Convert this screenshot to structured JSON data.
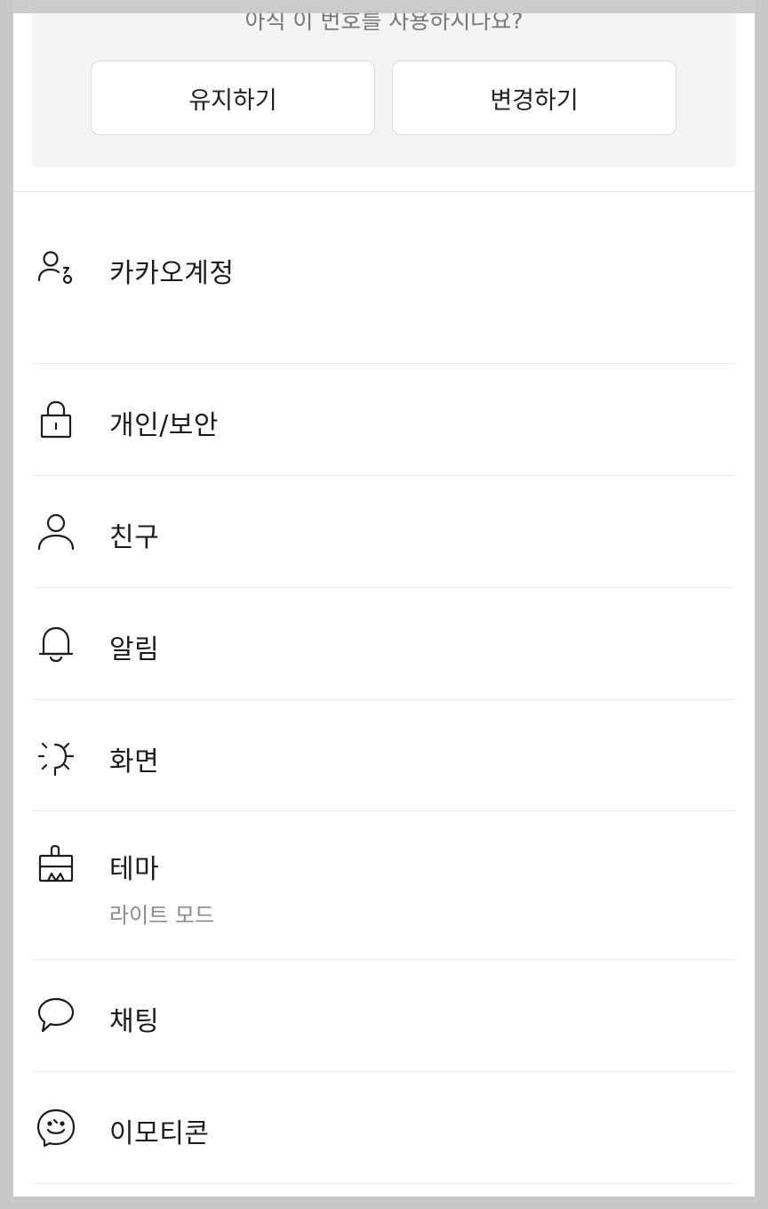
{
  "banner": {
    "question": "아직 이 번호를 사용하시나요?",
    "keep_label": "유지하기",
    "change_label": "변경하기"
  },
  "menu": {
    "items": [
      {
        "label": "카카오계정",
        "icon": "user-key-icon"
      },
      {
        "label": "개인/보안",
        "icon": "lock-icon"
      },
      {
        "label": "친구",
        "icon": "person-icon"
      },
      {
        "label": "알림",
        "icon": "bell-icon"
      },
      {
        "label": "화면",
        "icon": "brightness-icon"
      },
      {
        "label": "테마",
        "sub": "라이트 모드",
        "icon": "paint-brush-icon"
      },
      {
        "label": "채팅",
        "icon": "chat-bubble-icon"
      },
      {
        "label": "이모티콘",
        "icon": "smiley-icon"
      }
    ]
  },
  "colors": {
    "background": "#ffffff",
    "banner_bg": "#f4f4f4",
    "frame": "#c8c8c8",
    "text": "#1c1c1c",
    "subtext": "#8a8a8a"
  }
}
